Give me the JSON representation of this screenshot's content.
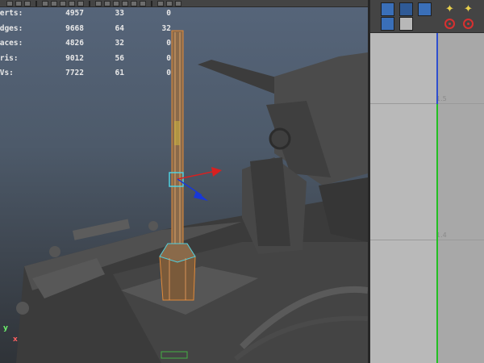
{
  "hud": {
    "rows": [
      {
        "label": "Verts:",
        "v1": "4957",
        "v2": "33",
        "v3": "0"
      },
      {
        "label": "Edges:",
        "v1": "9668",
        "v2": "64",
        "v3": "32"
      },
      {
        "label": "Faces:",
        "v1": "4826",
        "v2": "32",
        "v3": "0"
      },
      {
        "label": "Tris:",
        "v1": "9012",
        "v2": "56",
        "v3": "0"
      },
      {
        "label": "UVs:",
        "v1": "7722",
        "v2": "61",
        "v3": "0"
      }
    ]
  },
  "axis": {
    "y_label": "y",
    "x_label": "x"
  },
  "graph": {
    "tick_upper": "1.5",
    "tick_lower": "1.4"
  },
  "icons": {
    "toolbar": [
      "move-icon",
      "rotate-icon",
      "scale-icon",
      "select-icon",
      "snap-icon",
      "render-icon"
    ],
    "right_panel": [
      "grid-select-icon",
      "curve-tool-icon",
      "key-icon",
      "graph-icon",
      "tangent-icon",
      "star-icon",
      "ring-red-icon"
    ]
  },
  "colors": {
    "viewport_top": "#56657a",
    "wireframe_highlight": "#e08a3a",
    "selection_cyan": "#4fd0e0",
    "manip_red": "#d82020",
    "manip_blue": "#1838d8",
    "graph_bg": "#b9b9b9",
    "time_cursor_green": "#22c022"
  }
}
